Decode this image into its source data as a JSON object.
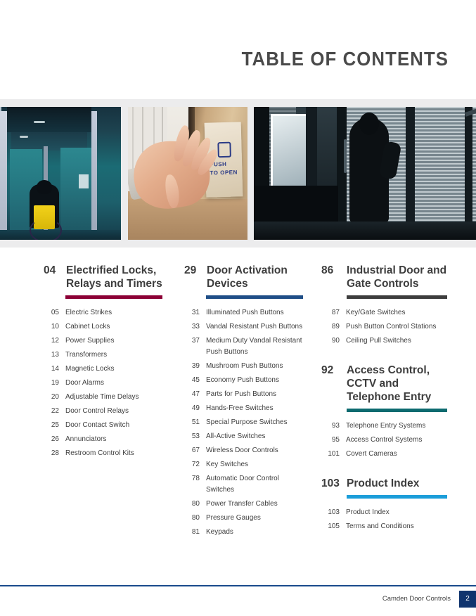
{
  "page": {
    "title": "TABLE OF CONTENTS"
  },
  "hero": {
    "photos": [
      {
        "name": "wheelchair-user-automatic-door",
        "alt": "Person in wheelchair entering through an automatic glass door"
      },
      {
        "name": "hand-push-to-open-plate",
        "alt": "Hand pressing a PUSH TO OPEN wall plate"
      },
      {
        "name": "silhouette-glass-entrance",
        "alt": "Silhouette of a person walking through glass entry doors"
      }
    ],
    "sign_text_line1": "PUSH",
    "sign_text_line2": "TO OPEN"
  },
  "colors": {
    "rule_burgundy": "#8c0035",
    "rule_blue": "#1f4e87",
    "rule_charcoal": "#3d3d3d",
    "rule_teal": "#0d6b70",
    "rule_cyan": "#1b9dd9",
    "footer_rule": "#1a4b8c",
    "page_badge": "#10346e",
    "band_bg": "#ececed"
  },
  "columns": [
    {
      "name": "column-1",
      "sections": [
        {
          "number": "04",
          "title": "Electrified Locks, Relays and Timers",
          "rule_color": "#8c0035",
          "entries": [
            {
              "page": "05",
              "label": "Electric Strikes"
            },
            {
              "page": "10",
              "label": "Cabinet Locks"
            },
            {
              "page": "12",
              "label": "Power Supplies"
            },
            {
              "page": "13",
              "label": "Transformers"
            },
            {
              "page": "14",
              "label": "Magnetic Locks"
            },
            {
              "page": "19",
              "label": "Door Alarms"
            },
            {
              "page": "20",
              "label": "Adjustable Time Delays"
            },
            {
              "page": "22",
              "label": "Door Control Relays"
            },
            {
              "page": "25",
              "label": "Door Contact Switch"
            },
            {
              "page": "26",
              "label": "Annunciators"
            },
            {
              "page": "28",
              "label": "Restroom Control Kits"
            }
          ]
        }
      ]
    },
    {
      "name": "column-2",
      "sections": [
        {
          "number": "29",
          "title": "Door Activation Devices",
          "rule_color": "#1f4e87",
          "entries": [
            {
              "page": "31",
              "label": "Illuminated Push Buttons"
            },
            {
              "page": "33",
              "label": "Vandal Resistant Push Buttons"
            },
            {
              "page": "37",
              "label": "Medium Duty Vandal Resistant Push Buttons"
            },
            {
              "page": "39",
              "label": "Mushroom Push Buttons"
            },
            {
              "page": "45",
              "label": "Economy Push Buttons"
            },
            {
              "page": "47",
              "label": "Parts for Push Buttons"
            },
            {
              "page": "49",
              "label": "Hands-Free Switches"
            },
            {
              "page": "51",
              "label": "Special Purpose Switches"
            },
            {
              "page": "53",
              "label": "All-Active Switches"
            },
            {
              "page": "67",
              "label": "Wireless Door Controls"
            },
            {
              "page": "72",
              "label": "Key Switches"
            },
            {
              "page": "78",
              "label": "Automatic Door Control Switches"
            },
            {
              "page": "80",
              "label": "Power Transfer Cables"
            },
            {
              "page": "80",
              "label": "Pressure Gauges"
            },
            {
              "page": "81",
              "label": "Keypads"
            }
          ]
        }
      ]
    },
    {
      "name": "column-3",
      "sections": [
        {
          "number": "86",
          "title": "Industrial Door and Gate Controls",
          "rule_color": "#3d3d3d",
          "entries": [
            {
              "page": "87",
              "label": "Key/Gate Switches"
            },
            {
              "page": "89",
              "label": "Push Button Control Stations"
            },
            {
              "page": "90",
              "label": "Ceiling Pull Switches"
            }
          ]
        },
        {
          "number": "92",
          "title": "Access Control, CCTV and Telephone Entry",
          "rule_color": "#0d6b70",
          "entries": [
            {
              "page": "93",
              "label": "Telephone Entry Systems"
            },
            {
              "page": "95",
              "label": "Access Control Systems"
            },
            {
              "page": "101",
              "label": "Covert Cameras"
            }
          ]
        },
        {
          "number": "103",
          "title": "Product Index",
          "rule_color": "#1b9dd9",
          "entries": [
            {
              "page": "103",
              "label": "Product Index"
            },
            {
              "page": "105",
              "label": "Terms and Conditions"
            }
          ]
        }
      ]
    }
  ],
  "footer": {
    "text": "Camden Door Controls",
    "page_number": "2"
  }
}
